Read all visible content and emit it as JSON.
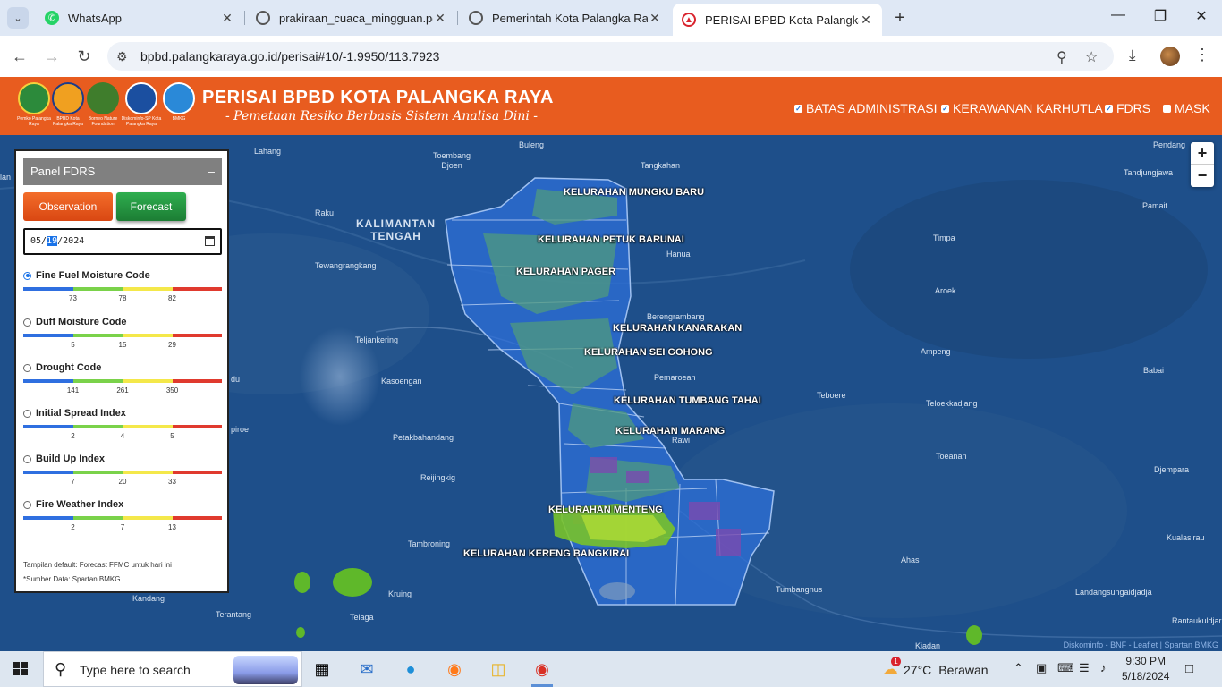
{
  "browser": {
    "tabs": [
      {
        "title": "WhatsApp",
        "icon": "whatsapp-icon"
      },
      {
        "title": "prakiraan_cuaca_mingguan.pdf",
        "icon": "globe-icon"
      },
      {
        "title": "Pemerintah Kota Palangka Raya",
        "icon": "globe-icon"
      },
      {
        "title": "PERISAI BPBD Kota Palangka Raya",
        "icon": "bpbd-icon"
      }
    ],
    "url": "bpbd.palangkaraya.go.id/perisai#10/-1.9950/113.7923"
  },
  "header": {
    "title": "PERISAI BPBD KOTA PALANGKA RAYA",
    "subtitle": "- Pemetaan Resiko Berbasis Sistem Analisa Dini -",
    "logos": [
      {
        "caption": "Pemko Palangka Raya",
        "color": "#2c8a3b"
      },
      {
        "caption": "BPBD Kota Palangka Raya",
        "color": "#f0a020"
      },
      {
        "caption": "Borneo Nature Foundation",
        "color": "#3f7d2c"
      },
      {
        "caption": "Diskominfo-SP Kota Palangka Raya",
        "color": "#1b4fa0"
      },
      {
        "caption": "BMKG",
        "color": "#2a89d8"
      }
    ],
    "layers": [
      {
        "label": "BATAS ADMINISTRASI",
        "checked": true
      },
      {
        "label": "KERAWANAN KARHUTLA",
        "checked": true
      },
      {
        "label": "FDRS",
        "checked": true
      },
      {
        "label": "MASK",
        "checked": false
      }
    ]
  },
  "panel": {
    "title": "Panel FDRS",
    "minimize": "–",
    "btn_observation": "Observation",
    "btn_forecast": "Forecast",
    "date_month": "05",
    "date_day": "19",
    "date_year": "2024",
    "scale_colors": [
      "#2f6fe0",
      "#7ad24a",
      "#f4e84a",
      "#e03a2e"
    ],
    "indices": [
      {
        "name": "Fine Fuel Moisture Code",
        "ticks": [
          "73",
          "78",
          "82"
        ],
        "selected": true
      },
      {
        "name": "Duff Moisture Code",
        "ticks": [
          "5",
          "15",
          "29"
        ],
        "selected": false
      },
      {
        "name": "Drought Code",
        "ticks": [
          "141",
          "261",
          "350"
        ],
        "selected": false
      },
      {
        "name": "Initial Spread Index",
        "ticks": [
          "2",
          "4",
          "5"
        ],
        "selected": false
      },
      {
        "name": "Build Up Index",
        "ticks": [
          "7",
          "20",
          "33"
        ],
        "selected": false
      },
      {
        "name": "Fire Weather Index",
        "ticks": [
          "2",
          "7",
          "13"
        ],
        "selected": false
      }
    ],
    "note1": "Tampilan default: Forecast FFMC untuk hari ini",
    "note2": "*Sumber Data: Spartan BMKG"
  },
  "map": {
    "province_label_1": "KALIMANTAN",
    "province_label_2": "TENGAH",
    "kelurahan": [
      "KELURAHAN MUNGKU BARU",
      "KELURAHAN PETUK BARUNAI",
      "KELURAHAN PAGER",
      "KELURAHAN KANARAKAN",
      "KELURAHAN SEI GOHONG",
      "KELURAHAN TUMBANG TAHAI",
      "KELURAHAN MARANG",
      "KELURAHAN MENTENG",
      "KELURAHAN KERENG BANGKIRAI"
    ],
    "places": [
      "Buleng",
      "Lahang",
      "Toembang Djoen",
      "Tangkahan",
      "Pendang",
      "Tandjungjawa",
      "Pamait",
      "Raku",
      "Hanua",
      "Timpa",
      "Tewangrangkang",
      "Aroek",
      "Berengrambang",
      "Teljankering",
      "Ampeng",
      "Babai",
      "Kasoengan",
      "Pemaroean",
      "Teboere",
      "Teloekkadjang",
      "Petakbahandang",
      "Rawi",
      "Toeanan",
      "Djempara",
      "Reijingkig",
      "Kualasirau",
      "Tambroning",
      "Ahas",
      "Kruing",
      "Tumbangnus",
      "Landangsungaidjadja",
      "Kandang",
      "Terantang",
      "Telaga",
      "Rantaukuldjar",
      "Kiadan",
      "du",
      "piroe",
      "lan"
    ],
    "zoom_in": "+",
    "zoom_out": "−",
    "attribution": "Diskominfo - BNF - Leaflet | Spartan BMKG"
  },
  "taskbar": {
    "search_placeholder": "Type here to search",
    "weather_temp": "27°C",
    "weather_desc": "Berawan",
    "weather_badge": "1",
    "time": "9:30 PM",
    "date": "5/18/2024"
  }
}
